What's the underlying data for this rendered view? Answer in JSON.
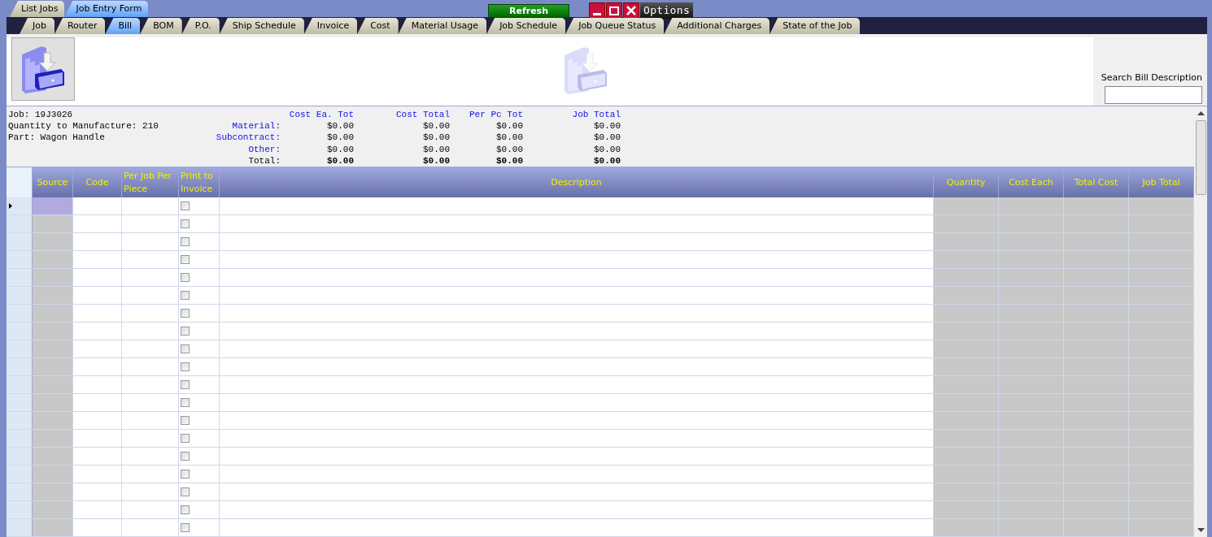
{
  "window_tabs": [
    {
      "label": "List Jobs",
      "selected": false
    },
    {
      "label": "Job Entry Form",
      "selected": true
    }
  ],
  "refresh_button": "Refresh",
  "options_button": "Options",
  "form_tabs": [
    {
      "label": "Job",
      "selected": false
    },
    {
      "label": "Router",
      "selected": false
    },
    {
      "label": "Bill",
      "selected": true
    },
    {
      "label": "BOM",
      "selected": false
    },
    {
      "label": "P.O.",
      "selected": false
    },
    {
      "label": "Ship Schedule",
      "selected": false
    },
    {
      "label": "Invoice",
      "selected": false
    },
    {
      "label": "Cost",
      "selected": false
    },
    {
      "label": "Material Usage",
      "selected": false
    },
    {
      "label": "Job Schedule",
      "selected": false
    },
    {
      "label": "Job Queue Status",
      "selected": false
    },
    {
      "label": "Additional Charges",
      "selected": false
    },
    {
      "label": "State of the Job",
      "selected": false
    }
  ],
  "search": {
    "label": "Search Bill Description"
  },
  "job_info": [
    "Job: 19J3026",
    "Quantity to Manufacture: 210",
    "Part: Wagon Handle"
  ],
  "cost_summary": {
    "columns": [
      "Cost Ea. Tot",
      "Cost Total",
      "Per Pc Tot",
      "Job Total"
    ],
    "rows": [
      {
        "label": "Material:",
        "kind": "category",
        "values": [
          "$0.00",
          "$0.00",
          "$0.00",
          "$0.00"
        ]
      },
      {
        "label": "Subcontract:",
        "kind": "category",
        "values": [
          "$0.00",
          "$0.00",
          "$0.00",
          "$0.00"
        ]
      },
      {
        "label": "Other:",
        "kind": "category",
        "values": [
          "$0.00",
          "$0.00",
          "$0.00",
          "$0.00"
        ]
      },
      {
        "label": "Total:",
        "kind": "total",
        "values": [
          "$0.00",
          "$0.00",
          "$0.00",
          "$0.00"
        ]
      }
    ]
  },
  "grid": {
    "columns": [
      {
        "label": "Source",
        "kind": "locked"
      },
      {
        "label": "Code",
        "kind": "text"
      },
      {
        "label": "Per Job Per Piece",
        "kind": "text"
      },
      {
        "label": "Print to Invoice",
        "kind": "checkbox"
      },
      {
        "label": "Description",
        "kind": "text"
      },
      {
        "label": "Quantity",
        "kind": "locked"
      },
      {
        "label": "Cost Each",
        "kind": "locked"
      },
      {
        "label": "Total Cost",
        "kind": "locked"
      },
      {
        "label": "Job Total",
        "kind": "locked"
      }
    ],
    "rows": [
      {
        "selected": true,
        "print_to_invoice": false
      },
      {
        "selected": false,
        "print_to_invoice": false
      },
      {
        "selected": false,
        "print_to_invoice": false
      },
      {
        "selected": false,
        "print_to_invoice": false
      },
      {
        "selected": false,
        "print_to_invoice": false
      },
      {
        "selected": false,
        "print_to_invoice": false
      },
      {
        "selected": false,
        "print_to_invoice": false
      },
      {
        "selected": false,
        "print_to_invoice": false
      },
      {
        "selected": false,
        "print_to_invoice": false
      },
      {
        "selected": false,
        "print_to_invoice": false
      },
      {
        "selected": false,
        "print_to_invoice": false
      },
      {
        "selected": false,
        "print_to_invoice": false
      },
      {
        "selected": false,
        "print_to_invoice": false
      },
      {
        "selected": false,
        "print_to_invoice": false
      },
      {
        "selected": false,
        "print_to_invoice": false
      },
      {
        "selected": false,
        "print_to_invoice": false
      },
      {
        "selected": false,
        "print_to_invoice": false
      },
      {
        "selected": false,
        "print_to_invoice": false
      },
      {
        "selected": false,
        "print_to_invoice": false
      }
    ]
  }
}
